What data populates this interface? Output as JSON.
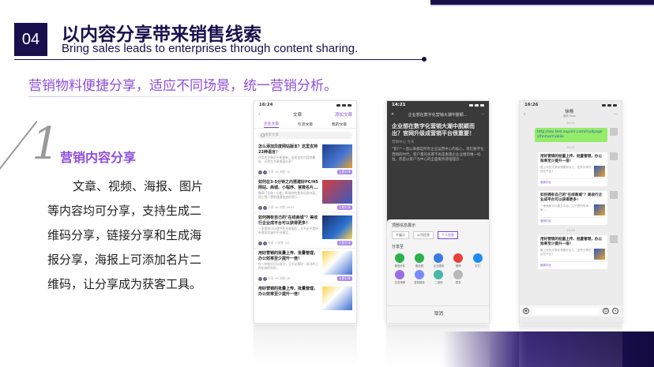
{
  "header": {
    "number": "04",
    "title": "以内容分享带来销售线索",
    "subtitle": "Bring sales leads to enterprises through content sharing."
  },
  "tagline": "营销物料便捷分享，适应不同场景，统一营销分析。",
  "feature": {
    "index": "1",
    "title": "营销内容分享",
    "body": "文章、视频、海报、图片等内容均可分享，支持生成二维码分享，链接分享和生成海报分享，海报上可添加名片二维码，让分享成为获客工具。"
  },
  "colors": {
    "navy": "#1a0f4d",
    "purple": "#8f4fd8"
  },
  "phone1": {
    "time": "16:24",
    "nav_title": "文章",
    "nav_action": "添加文章",
    "tabs": [
      "企业文章",
      "引流文章",
      "我的文章"
    ],
    "search_placeholder": "搜索文章",
    "articles": [
      {
        "title": "怎么添加异度网站版本？这里支持22种语言！",
        "desc": "作用的文章会不断更新，这里这些内容你最好，还是在文章里面分享！",
        "meta": "分享 18  浏览 18",
        "pill": "立即分享"
      },
      {
        "title": "如何在3-5分钟之内搭建好PC/H5网站、商城、小程序、官微名片...",
        "desc": "微网「总站」功能，帮助你的更多优良内容，网上统一营销通通快速的进行...",
        "meta": "分享 46  浏览 4997",
        "pill": "立即分享"
      },
      {
        "title": "如何拥有自己的\"在线商城\"？美收行企业成平台可以获得更多！",
        "desc": "一家两家可以建平台共有服务，又不必不是所有商家实施的平台建设...",
        "meta": "分享 7  浏览 2/5",
        "pill": "立即分享"
      },
      {
        "title": "用好营销的批量上传、批量管理，办公效率至少提升一倍！",
        "desc": "在一种相对可以有关，又不必那样一系列的上传机制的利用...",
        "meta": "分享 46  浏览 46",
        "pill": "立即分享"
      },
      {
        "title": "用好营销的批量上传、批量管理，办公效率至少提升一倍！",
        "desc": "",
        "meta": "",
        "pill": ""
      }
    ]
  },
  "phone2": {
    "time": "14:21",
    "nav_title": "企业想在数字化营销大潮中脱颖...",
    "article_title": "企业想在数字化营销大潮中脱颖而出？官网升级成营销平台很重要！",
    "meta": "营销中心 今天",
    "body": "\"客户\"一直以来都是所有企业运营中心的核心，现在数字化营销的时代，客户量的多寡不再是衡量企业业绩的唯一标准，而是以客户为中心的全面服务管理理念...",
    "sheet_title": "顶部信息展示",
    "chips": [
      "不展示",
      "公司信息",
      "个人信息"
    ],
    "share_title": "分享至",
    "share_items": [
      {
        "label": "微信好友",
        "color": "#2bb24c"
      },
      {
        "label": "朋友圈",
        "color": "#2bb24c"
      },
      {
        "label": "企业微信",
        "color": "#3a79e0"
      },
      {
        "label": "微博",
        "color": "#e6413b"
      },
      {
        "label": "钉钉",
        "color": "#1f8cf3"
      },
      {
        "label": "生成海报",
        "color": "#9b6ce8"
      },
      {
        "label": "复制链接",
        "color": "#7b8bff"
      },
      {
        "label": "二维码",
        "color": "#47b7a8"
      },
      {
        "label": "更多",
        "color": "#b9b9b9"
      }
    ],
    "cancel": "取消"
  },
  "phone3": {
    "time": "16:26",
    "contact": "徐杨",
    "contact_sub": "营销 Saas",
    "link_msg": "http://sss.test.supeirr.com/mallpages/home/mobile",
    "time_1": "16:25",
    "time_2": "16:25",
    "time_3": "16:26",
    "cards": [
      {
        "title": "用好营销的批量上传、批量管理，办公效率至少提升一倍！",
        "desc": "要上传的文章你想要好点儿，还有分享的还在不足？",
        "src": "营销平台"
      },
      {
        "title": "如何拥有自己的\"在线商城\"？美收行企业成平台可以获得更多！",
        "desc": "一家两家可以建立平台，又不是所有商家...",
        "src": "营销平台"
      },
      {
        "title": "用好营销的批量上传、批量管理，办公效率至少提升一倍！",
        "desc": "要上传的文章你想要好点儿，还有分享的还在不足？",
        "src": "营销平台"
      }
    ]
  }
}
